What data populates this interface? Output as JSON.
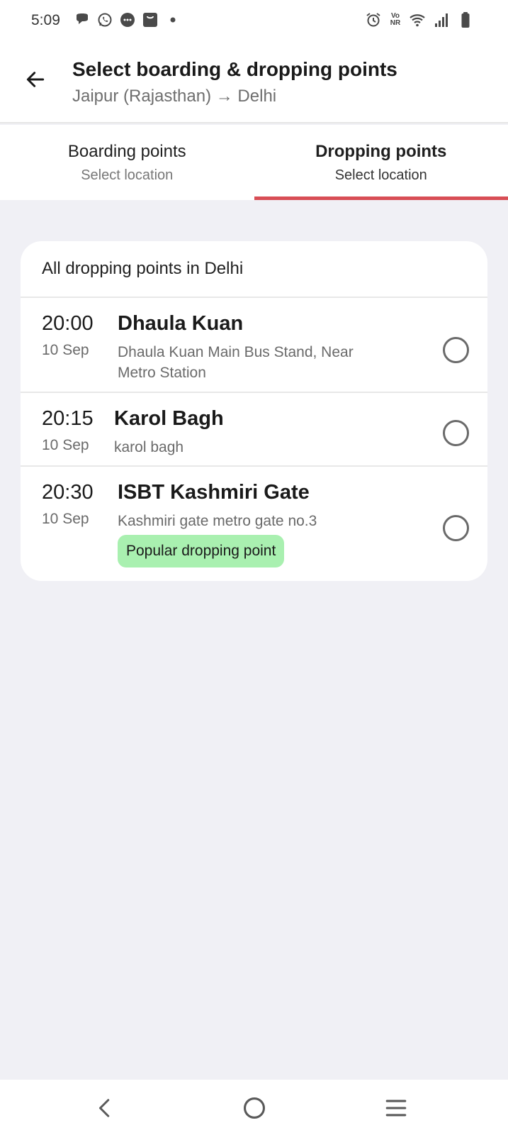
{
  "status_bar": {
    "time": "5:09",
    "volte_top": "Vo",
    "volte_bottom": "NR",
    "left_icons": [
      "chat-bubble-icon",
      "whatsapp-icon",
      "message-icon",
      "shopping-bag-icon",
      "dot-icon"
    ],
    "right_icons": [
      "alarm-icon",
      "volte-icon",
      "wifi-icon",
      "signal-icon",
      "battery-icon"
    ]
  },
  "header": {
    "title": "Select boarding & dropping points",
    "route": "Jaipur (Rajasthan) → Delhi"
  },
  "tabs": [
    {
      "title": "Boarding points",
      "subtitle": "Select location",
      "active": false
    },
    {
      "title": "Dropping points",
      "subtitle": "Select location",
      "active": true
    }
  ],
  "card": {
    "heading": "All dropping points in Delhi",
    "points": [
      {
        "time": "20:00",
        "date": "10 Sep",
        "name": "Dhaula Kuan",
        "address": "Dhaula Kuan Main Bus Stand, Near Metro Station",
        "tag": null,
        "selected": false
      },
      {
        "time": "20:15",
        "date": "10 Sep",
        "name": "Karol Bagh",
        "address": "karol bagh",
        "tag": null,
        "selected": false
      },
      {
        "time": "20:30",
        "date": "10 Sep",
        "name": "ISBT Kashmiri Gate",
        "address": "Kashmiri gate metro gate no.3",
        "tag": "Popular dropping point",
        "selected": false
      }
    ]
  },
  "colors": {
    "accent": "#d84e55",
    "popular_tag": "#a9f0b0",
    "background": "#f0f0f5"
  },
  "nav_bar": {
    "buttons": [
      "back-icon",
      "home-icon",
      "recents-icon"
    ]
  }
}
